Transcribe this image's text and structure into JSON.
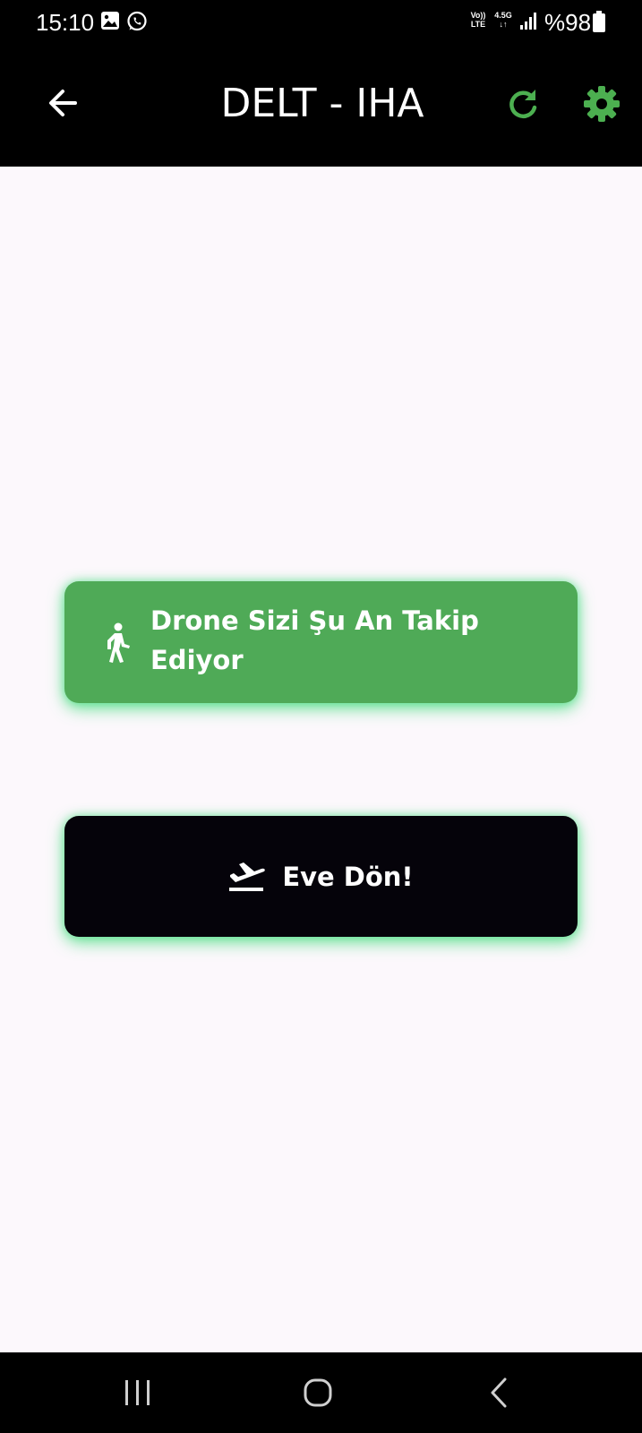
{
  "status_bar": {
    "time": "15:10",
    "volte_label": "Vo))\nLTE",
    "network_label": "4.5G\n↓↑",
    "battery": "%98",
    "icons": [
      "gallery-icon",
      "whatsapp-icon",
      "signal-icon",
      "battery-icon"
    ]
  },
  "app_bar": {
    "title": "DELT - IHA",
    "back_icon": "arrow-left-icon",
    "refresh_icon": "refresh-icon",
    "settings_icon": "gear-icon",
    "accent_color": "#4caf50"
  },
  "follow_button": {
    "label": "Drone Sizi Şu An Takip Ediyor",
    "icon": "walking-person-icon",
    "background_color": "#4faa57"
  },
  "home_button": {
    "label": "Eve Dön!",
    "icon": "flight-takeoff-icon",
    "background_color": "#05030a"
  },
  "nav_bar": {
    "icons": [
      "recents-icon",
      "home-icon",
      "back-icon"
    ]
  }
}
